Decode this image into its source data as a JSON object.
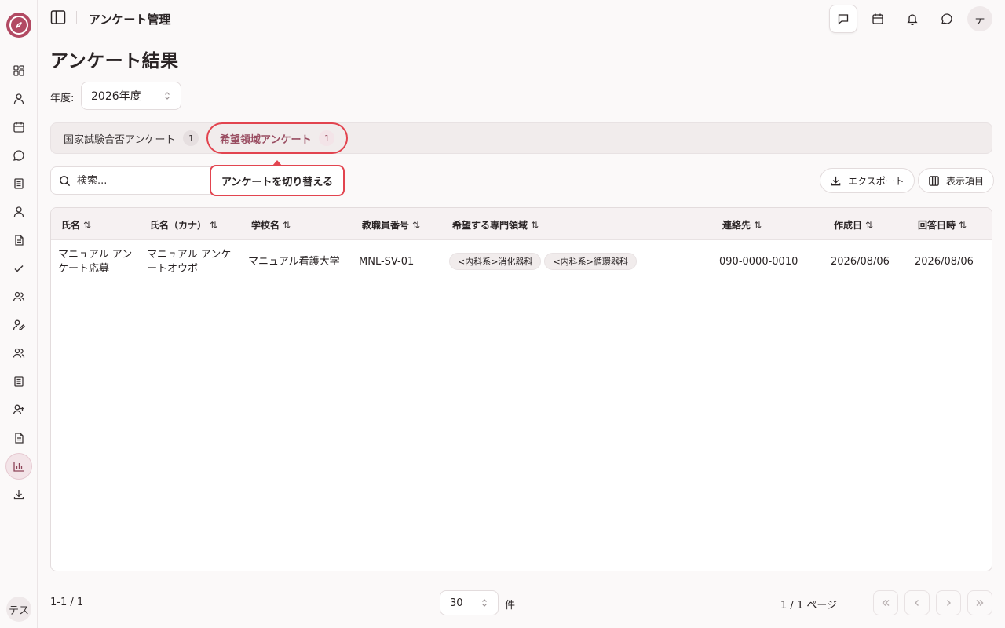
{
  "sidebar": {
    "icons": [
      "dashboard-icon",
      "user-icon",
      "calendar-icon",
      "chat-icon",
      "document-icon",
      "person-icon",
      "file-icon",
      "check-icon",
      "users-icon",
      "user-edit-icon",
      "group-icon",
      "list-icon",
      "user-plus-icon",
      "report-icon",
      "chart-icon",
      "download-icon"
    ],
    "active": "chart-icon",
    "avatar_text": "テス"
  },
  "header": {
    "title": "アンケート管理",
    "avatar_text": "テ"
  },
  "page": {
    "title": "アンケート結果",
    "year_label": "年度:",
    "year_value": "2026年度"
  },
  "tabs": [
    {
      "label": "国家試験合否アンケート",
      "count": "1"
    },
    {
      "label": "希望領域アンケート",
      "count": "1"
    }
  ],
  "tooltip": "アンケートを切り替える",
  "search": {
    "placeholder": "検索..."
  },
  "toolbar": {
    "export_label": "エクスポート",
    "columns_label": "表示項目"
  },
  "table": {
    "headers": [
      "氏名",
      "氏名（カナ）",
      "学校名",
      "教職員番号",
      "希望する専門領域",
      "連絡先",
      "作成日",
      "回答日時"
    ],
    "rows": [
      {
        "name_line1": "マニュアル アン",
        "name_line2": "ケート応募",
        "kana_line1": "マニュアル アンケ",
        "kana_line2": "ートオウボ",
        "school": "マニュアル看護大学",
        "staff_no": "MNL-SV-01",
        "areas": [
          "<内科系>消化器科",
          "<内科系>循環器科"
        ],
        "contact": "090-0000-0010",
        "created": "2026/08/06",
        "answered": "2026/08/06"
      }
    ]
  },
  "footer": {
    "range": "1-1 / 1",
    "per_page": "30",
    "per_page_unit": "件",
    "page_info": "1 / 1 ページ"
  },
  "colors": {
    "accent": "#9a4e62",
    "highlight": "#e2444f",
    "brand": "#b24a63"
  }
}
